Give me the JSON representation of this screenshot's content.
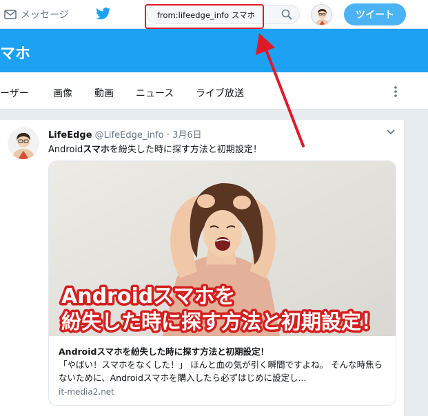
{
  "topbar": {
    "messages_label": "メッセージ",
    "search_value": "from:lifeedge_info スマホ",
    "tweet_button_label": "ツイート"
  },
  "header": {
    "query_title": "マホ"
  },
  "tabs": [
    {
      "label": "ーザー"
    },
    {
      "label": "画像"
    },
    {
      "label": "動画"
    },
    {
      "label": "ニュース"
    },
    {
      "label": "ライブ放送"
    }
  ],
  "tweet": {
    "name": "LifeEdge",
    "handle": "@LifeEdge_info",
    "separator": "·",
    "date": "3月6日",
    "text_pre": "Android",
    "text_bold": "スマホ",
    "text_post": "を紛失した時に探す方法と初期設定！",
    "card": {
      "image_banner_line1": "Androidスマホを",
      "image_banner_line2": "紛失した時に探す方法と初期設定！",
      "title": "Androidスマホを紛失した時に探す方法と初期設定！",
      "description": "「やばい！スマホをなくした！」 ほんと血の気が引く瞬間ですよね。 そんな時焦らないために、Androidスマホを購入したら必ずはじめに設定し...",
      "domain": "it-media2.net"
    }
  },
  "colors": {
    "brand_blue": "#1da1f2",
    "tweet_button": "#4ab3f4",
    "highlight_red": "#e0182a"
  }
}
